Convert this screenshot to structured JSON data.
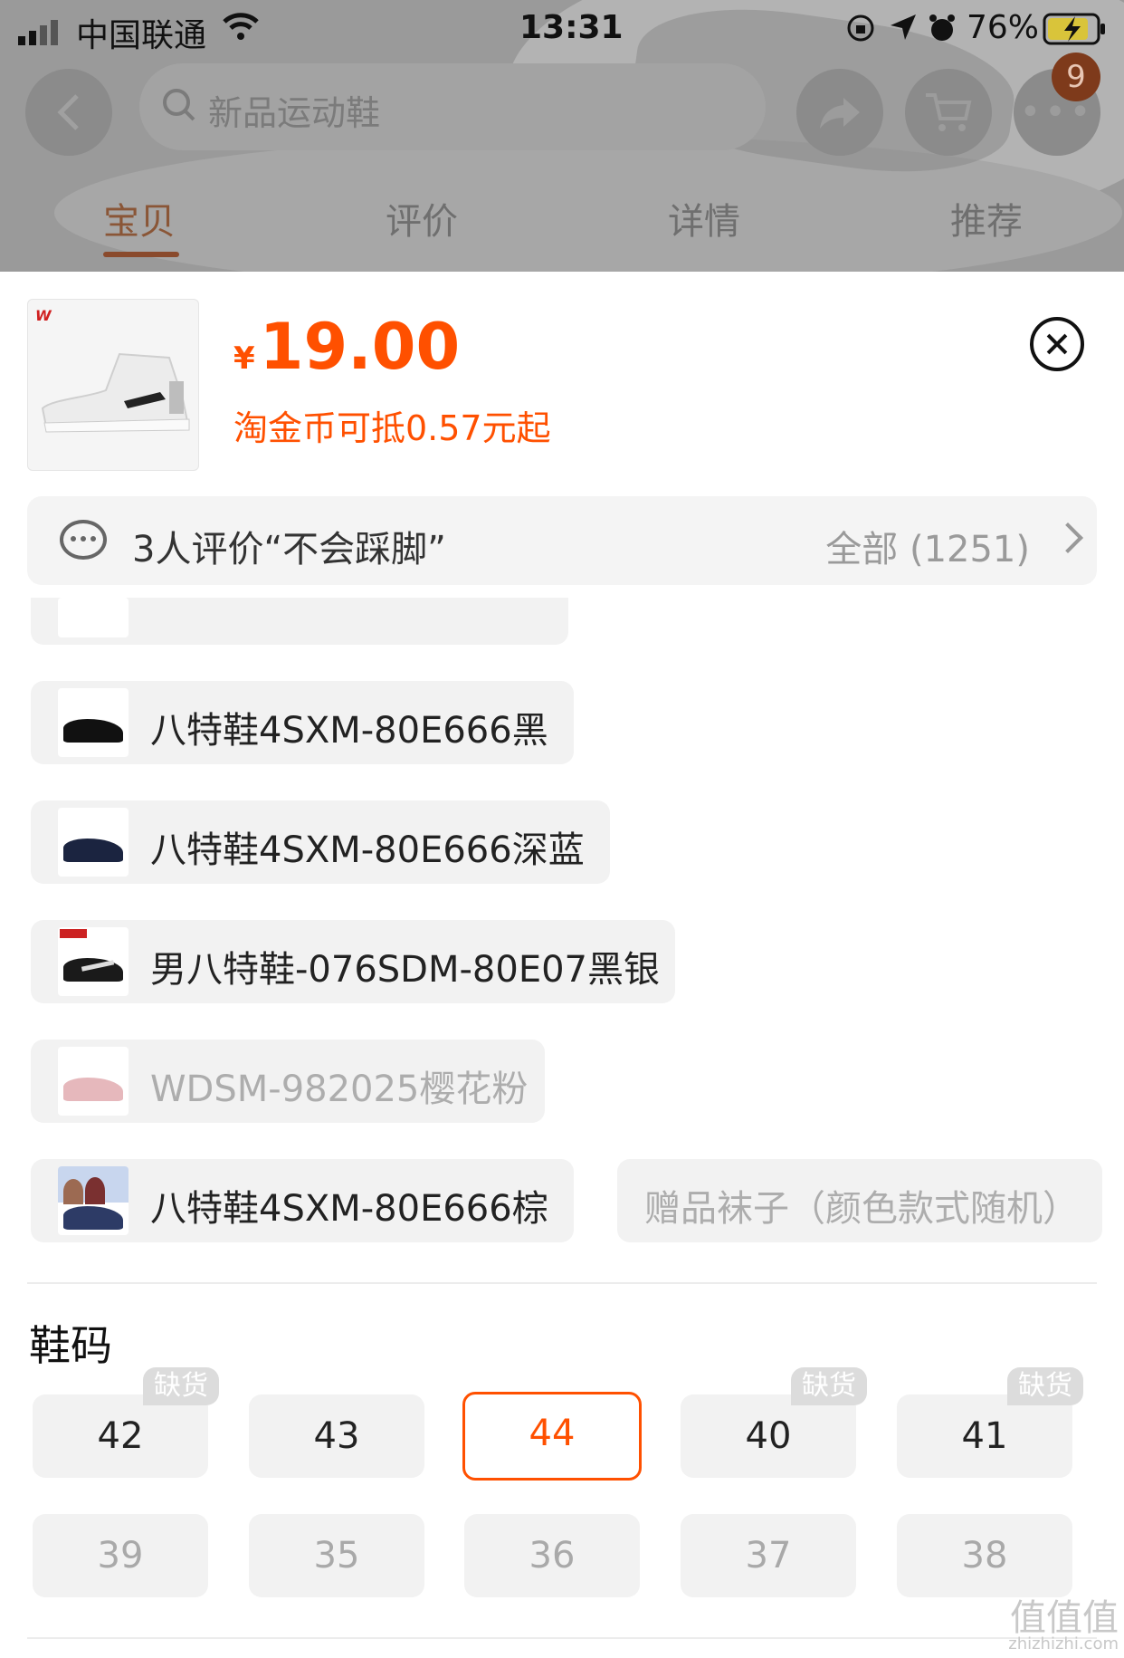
{
  "status_bar": {
    "carrier": "中国联通",
    "time": "13:31",
    "battery": "76%"
  },
  "header": {
    "search_placeholder": "新品运动鞋",
    "cart_badge": "9"
  },
  "tabs": [
    {
      "label": "宝贝",
      "active": true
    },
    {
      "label": "评价",
      "active": false
    },
    {
      "label": "详情",
      "active": false
    },
    {
      "label": "推荐",
      "active": false
    }
  ],
  "product": {
    "currency": "¥",
    "price": "19.00",
    "coin_note": "淘金币可抵0.57元起"
  },
  "review_bar": {
    "text": "3人评价“不会踩脚”",
    "all": "全部 (1251)"
  },
  "color_options": [
    {
      "label": "八特鞋4SXM-80E666黑",
      "disabled": false
    },
    {
      "label": "八特鞋4SXM-80E666深蓝",
      "disabled": false
    },
    {
      "label": "男八特鞋-076SDM-80E07黑银",
      "disabled": false
    },
    {
      "label": "WDSM-982025樱花粉",
      "disabled": true
    },
    {
      "label": "八特鞋4SXM-80E666棕",
      "disabled": false
    },
    {
      "label": "赠品袜子（颜色款式随机）",
      "disabled": true
    }
  ],
  "sizes": {
    "title": "鞋码",
    "out_of_stock_label": "缺货",
    "row1": [
      {
        "value": "42",
        "state": "oos"
      },
      {
        "value": "43",
        "state": "normal"
      },
      {
        "value": "44",
        "state": "selected"
      },
      {
        "value": "40",
        "state": "oos"
      },
      {
        "value": "41",
        "state": "oos"
      }
    ],
    "row2": [
      {
        "value": "39",
        "state": "disabled"
      },
      {
        "value": "35",
        "state": "disabled"
      },
      {
        "value": "36",
        "state": "disabled"
      },
      {
        "value": "37",
        "state": "disabled"
      },
      {
        "value": "38",
        "state": "disabled"
      }
    ]
  },
  "watermark": {
    "text": "值值值",
    "url": "zhizhizhi.com"
  },
  "colors": {
    "accent": "#ff5000"
  }
}
